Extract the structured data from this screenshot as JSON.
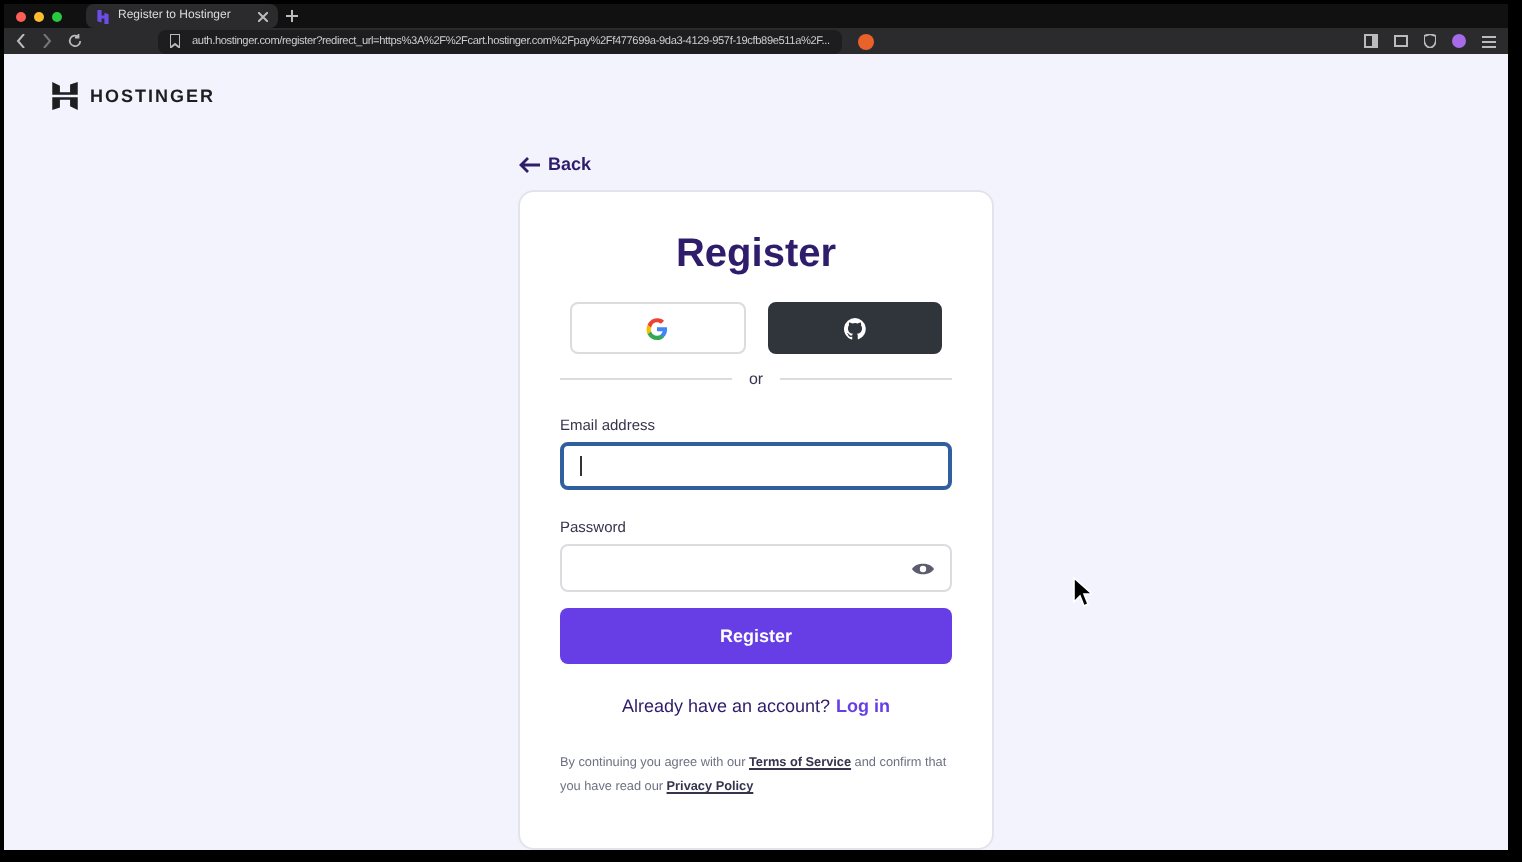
{
  "browser": {
    "tab": {
      "title": "Register to Hostinger",
      "selected": true
    },
    "url": "auth.hostinger.com/register?redirect_url=https%3A%2F%2Fcart.hostinger.com%2Fpay%2Ff477699a-9da3-4129-957f-19cfb89e511a%2F..."
  },
  "header": {
    "logo": "HOSTINGER"
  },
  "back_link": "Back",
  "form": {
    "title": "Register",
    "separator": "or",
    "fields": [
      {
        "label": "Email address",
        "focused": true,
        "kind": "email"
      },
      {
        "label": "Password",
        "focused": false,
        "kind": "password"
      }
    ],
    "submit": "Register",
    "login_prompt": "Already have an account?",
    "login_link": "Log in",
    "terms": "By continuing you agree with our **Terms of Service** and confirm that you have read our **Privacy Policy**"
  }
}
